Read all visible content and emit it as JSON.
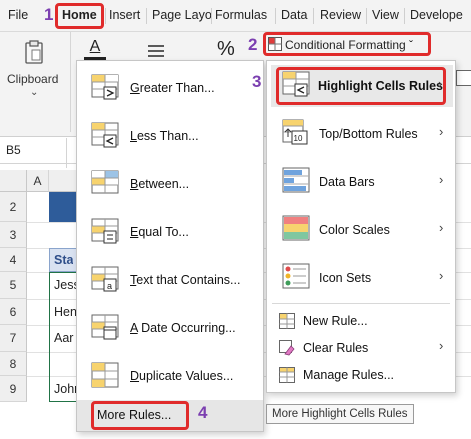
{
  "tabs": [
    "File",
    "Home",
    "Insert",
    "Page Layo",
    "Formulas",
    "Data",
    "Review",
    "View",
    "Develope"
  ],
  "steps": [
    "1",
    "2",
    "3",
    "4"
  ],
  "ribbon": {
    "clipboard_label": "Clipboard",
    "font_icon_text": "A",
    "number_icon_text": "%",
    "conditional_formatting_label": "Conditional Formatting ˇ"
  },
  "name_box": "B5",
  "columns": [
    "A"
  ],
  "rows": [
    "2",
    "3",
    "4",
    "5",
    "6",
    "7",
    "8",
    "9"
  ],
  "cells": [
    "Sta",
    "Jess",
    "Hen",
    "Aar",
    "John"
  ],
  "left_menu": {
    "items": [
      {
        "label": "Greater Than...",
        "underline": "G",
        "rest": "reater Than..."
      },
      {
        "label": "Less Than...",
        "underline": "L",
        "rest": "ess Than..."
      },
      {
        "label": "Between...",
        "underline": "B",
        "rest": "etween..."
      },
      {
        "label": "Equal To...",
        "underline": "E",
        "rest": "qual To..."
      },
      {
        "label": "Text that Contains...",
        "underline": "T",
        "rest": "ext that Contains..."
      },
      {
        "label": "A Date Occurring...",
        "underline": "A",
        "rest": " Date Occurring..."
      },
      {
        "label": "Duplicate Values...",
        "underline": "D",
        "rest": "uplicate Values..."
      }
    ],
    "more_rules": "More Rules..."
  },
  "right_menu": {
    "main_items": [
      "Highlight Cells Rules",
      "Top/Bottom Rules",
      "Data Bars",
      "Color Scales",
      "Icon Sets"
    ],
    "sub_items": [
      "New Rule...",
      "Clear Rules",
      "Manage Rules..."
    ]
  },
  "tooltip": "More Highlight Cells Rules",
  "colors": {
    "accent_red": "#e02b2b",
    "step_purple": "#7b3fb0",
    "excel_green": "#217346",
    "hover_gray": "#e6e6e6"
  }
}
